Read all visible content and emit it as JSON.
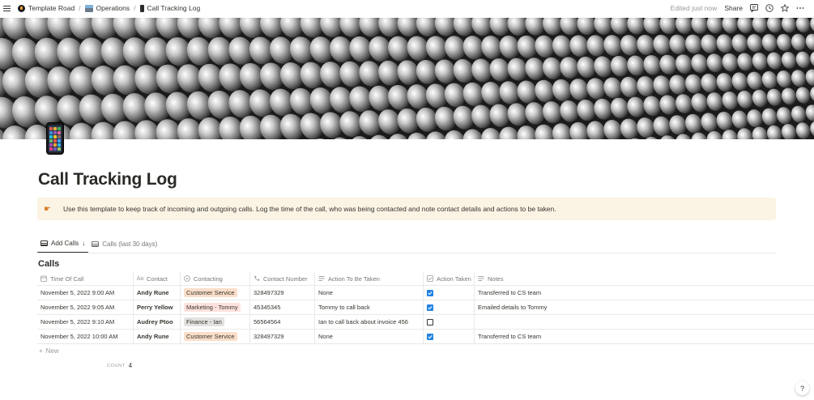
{
  "topbar": {
    "breadcrumbs": [
      {
        "label": "Template Road",
        "icon": "template-road-logo-icon"
      },
      {
        "label": "Operations",
        "icon": "office-building-icon"
      },
      {
        "label": "Call Tracking Log",
        "icon": "mobile-phone-icon"
      }
    ],
    "separator": "/",
    "edited": "Edited just now",
    "share": "Share"
  },
  "page": {
    "title": "Call Tracking Log",
    "callout": "Use this template to keep track of incoming and outgoing calls. Log the time of the call, who was being contacted and note contact details and actions to be taken."
  },
  "tabs": [
    {
      "label": "Add Calls",
      "active": true,
      "sort_icon": "↓"
    },
    {
      "label": "Calls (last 30 days)",
      "active": false
    }
  ],
  "database": {
    "title": "Calls",
    "columns": [
      "Time Of Call",
      "Contact",
      "Contacting",
      "Contact Number",
      "Action To Be Taken",
      "Action Taken",
      "Notes"
    ],
    "rows": [
      {
        "time": "November 5, 2022 9:00 AM",
        "contact": "Andy Rune",
        "contacting": "Customer Service",
        "tag_color": "#fadec9",
        "number": "328497329",
        "action": "None",
        "taken": true,
        "notes": "Transferred to CS team"
      },
      {
        "time": "November 5, 2022 9:05 AM",
        "contact": "Perry Yellow",
        "contacting": "Marketing - Tommy",
        "tag_color": "#ffe2dd",
        "number": "45345345",
        "action": "Tommy to call back",
        "taken": true,
        "notes": "Emailed details to Tommy"
      },
      {
        "time": "November 5, 2022 9:10 AM",
        "contact": "Audrey Ptoo",
        "contacting": "Finance - Ian",
        "tag_color": "#e3e2e0",
        "number": "56564564",
        "action": "Ian to call back about invoice 456",
        "taken": false,
        "notes": ""
      },
      {
        "time": "November 5, 2022 10:00 AM",
        "contact": "Andy Rune",
        "contacting": "Customer Service",
        "tag_color": "#fadec9",
        "number": "328497329",
        "action": "None",
        "taken": true,
        "notes": "Transferred to CS team"
      }
    ],
    "new_label": "New",
    "count_label": "COUNT",
    "count_value": "4"
  },
  "help": "?"
}
